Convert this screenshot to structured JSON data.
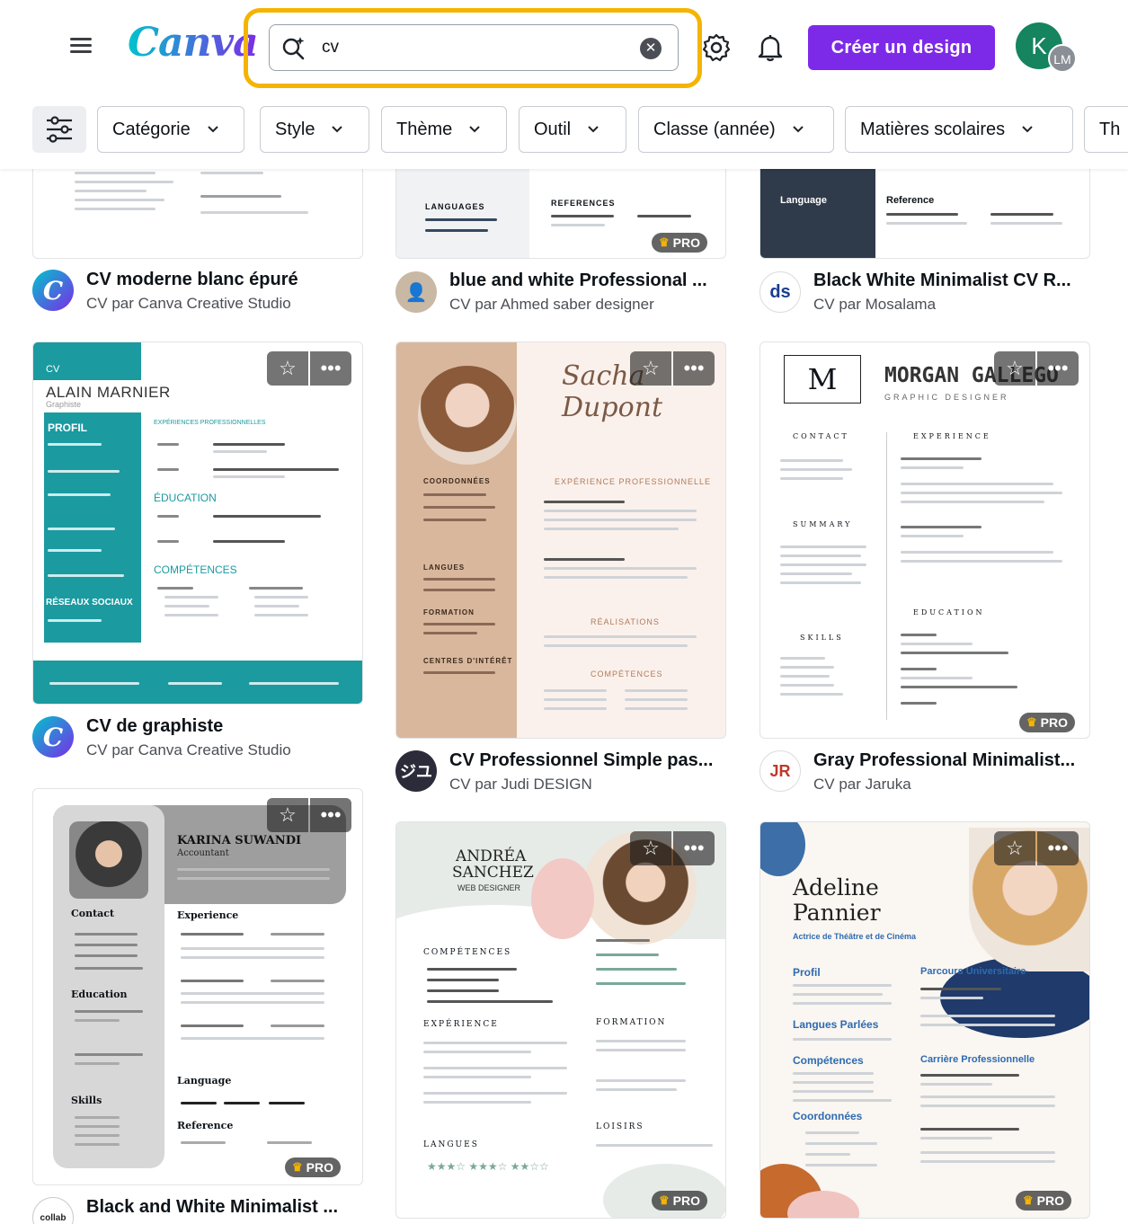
{
  "header": {
    "logo": "Canva",
    "search_value": "cv",
    "search_icon": "magic-search-icon",
    "clear_icon": "clear-icon",
    "create_button": "Créer un design",
    "avatar_initial": "K",
    "avatar_secondary": "LM"
  },
  "filters": [
    {
      "label": "Catégorie"
    },
    {
      "label": "Style"
    },
    {
      "label": "Thème"
    },
    {
      "label": "Outil"
    },
    {
      "label": "Classe (année)"
    },
    {
      "label": "Matières scolaires"
    },
    {
      "label": "Th"
    }
  ],
  "cards": {
    "c1": {
      "title": "CV moderne blanc épuré",
      "subtitle": "CV par Canva Creative Studio"
    },
    "c2": {
      "title": "blue and white Professional ...",
      "subtitle": "CV par Ahmed saber designer"
    },
    "c3": {
      "title": "Black White Minimalist CV R...",
      "subtitle": "CV par Mosalama"
    },
    "c4": {
      "title": "CV de graphiste",
      "subtitle": "CV par Canva Creative Studio"
    },
    "c5": {
      "title": "CV Professionnel Simple pas...",
      "subtitle": "CV par Judi DESIGN"
    },
    "c6": {
      "title": "Gray Professional Minimalist...",
      "subtitle": "CV par Jaruka"
    },
    "c7": {
      "title": "Black and White Minimalist ..."
    }
  },
  "badges": {
    "pro": "PRO"
  },
  "previews": {
    "alain": {
      "cv": "CV",
      "name": "ALAIN MARNIER",
      "role": "Graphiste",
      "profil": "PROFIL",
      "education": "ÉDUCATION",
      "competences": "COMPÉTENCES",
      "reseaux": "RÉSEAUX SOCIAUX",
      "experiences": "EXPÉRIENCES PROFESSIONNELLES"
    },
    "sacha": {
      "coordonnees": "COORDONNÉES",
      "langues": "LANGUES",
      "formation": "FORMATION",
      "centres": "CENTRES D'INTÉRÊT",
      "experience": "EXPÉRIENCE PROFESSIONNELLE",
      "realisations": "RÉALISATIONS",
      "competences": "COMPÉTENCES"
    },
    "morgan": {
      "name": "MORGAN GALLEGO",
      "role": "GRAPHIC DESIGNER",
      "contact": "CONTACT",
      "summary": "SUMMARY",
      "skills": "SKILLS",
      "experience": "EXPERIENCE",
      "education": "EDUCATION"
    },
    "karina": {
      "name": "KARINA SUWANDI",
      "role": "Accountant",
      "contact": "Contact",
      "education": "Education",
      "skills": "Skills",
      "experience": "Experience",
      "language": "Language",
      "reference": "Reference"
    },
    "andrea": {
      "name1": "ANDRÉA",
      "name2": "SANCHEZ",
      "role": "WEB DESIGNER",
      "competences": "COMPÉTENCES",
      "experience": "EXPÉRIENCE",
      "langues": "LANGUES",
      "formation": "FORMATION",
      "loisirs": "LOISIRS"
    },
    "adeline": {
      "name1": "Adeline",
      "name2": "Pannier",
      "role": "Actrice de Théâtre et de Cinéma",
      "profil": "Profil",
      "langues": "Langues Parlées",
      "competences": "Compétences",
      "coordonnees": "Coordonnées",
      "parcours": "Parcours Universitaire",
      "carriere": "Carrière Professionnelle"
    },
    "top2": {
      "languages": "LANGUAGES",
      "references": "REFERENCES"
    },
    "top3": {
      "language": "Language",
      "reference": "Reference"
    }
  }
}
